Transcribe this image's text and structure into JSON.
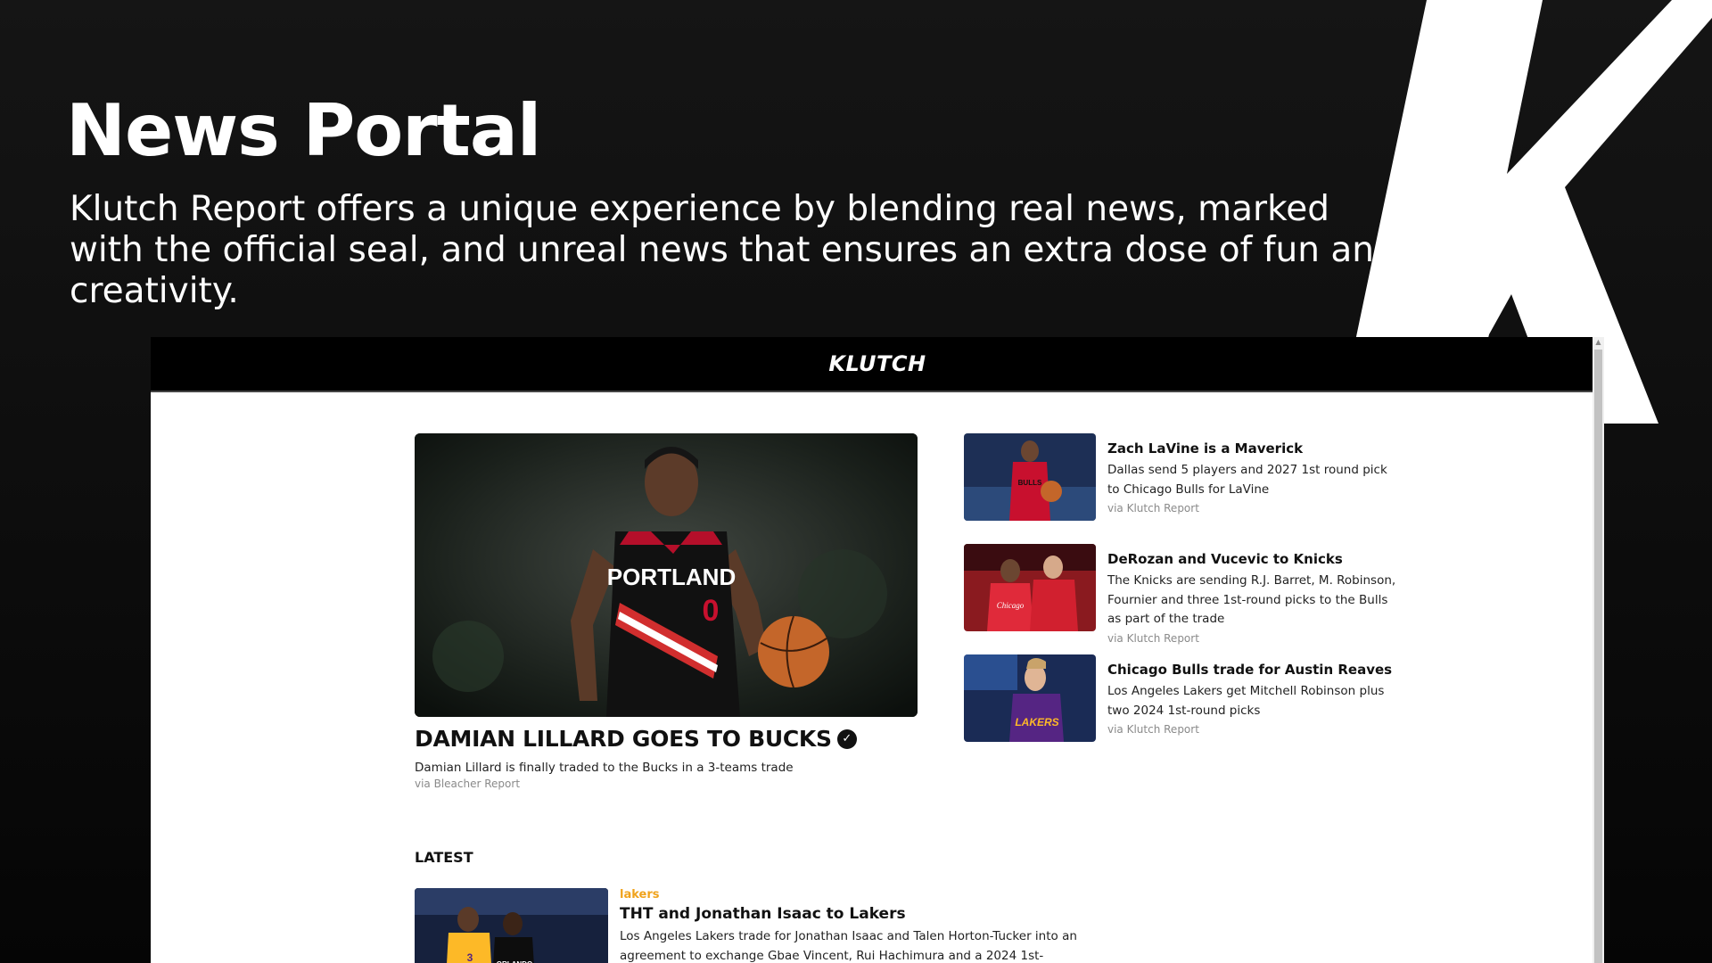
{
  "hero": {
    "title": "News Portal",
    "description": "Klutch Report offers a unique experience by blending real news, marked with the official seal, and unreal news that ensures an extra dose of fun and creativity."
  },
  "app": {
    "logo": "KLUTCH"
  },
  "main_story": {
    "title": "DAMIAN LILLARD GOES TO BUCKS",
    "verified_icon": "verified-check-icon",
    "description": "Damian Lillard is finally traded to the Bucks in a 3-teams trade",
    "source": "via Bleacher Report",
    "jersey_text": "PORTLAND",
    "jersey_number": "0"
  },
  "side_stories": [
    {
      "title": "Zach LaVine is a Maverick",
      "description": "Dallas send 5 players and 2027 1st round pick to Chicago Bulls for LaVine",
      "source": "via Klutch Report",
      "jersey_text": "BULLS"
    },
    {
      "title": "DeRozan and Vucevic to Knicks",
      "description": "The Knicks are sending R.J. Barret, M. Robinson, Fournier and three 1st-round picks to the Bulls as part of the trade",
      "source": "via Klutch Report",
      "jersey_text": "Chicago"
    },
    {
      "title": "Chicago Bulls trade for Austin Reaves",
      "description": "Los Angeles Lakers get Mitchell Robinson plus two 2024 1st-round picks",
      "source": "via Klutch Report",
      "jersey_text": "LAKERS"
    }
  ],
  "latest": {
    "label": "LATEST",
    "items": [
      {
        "category": "lakers",
        "title": "THT and Jonathan Isaac to Lakers",
        "description": "Los Angeles Lakers trade for Jonathan Isaac and Talen Horton-Tucker into an agreement to exchange Gbae Vincent, Rui Hachimura and a 2024 1st-"
      }
    ]
  },
  "colors": {
    "accent_category": "#f0a31c",
    "topbar": "#000000",
    "bulls_red": "#c8102e",
    "blazers_red": "#d12e2e",
    "lakers_purple": "#552583",
    "lakers_gold": "#fdb927"
  }
}
